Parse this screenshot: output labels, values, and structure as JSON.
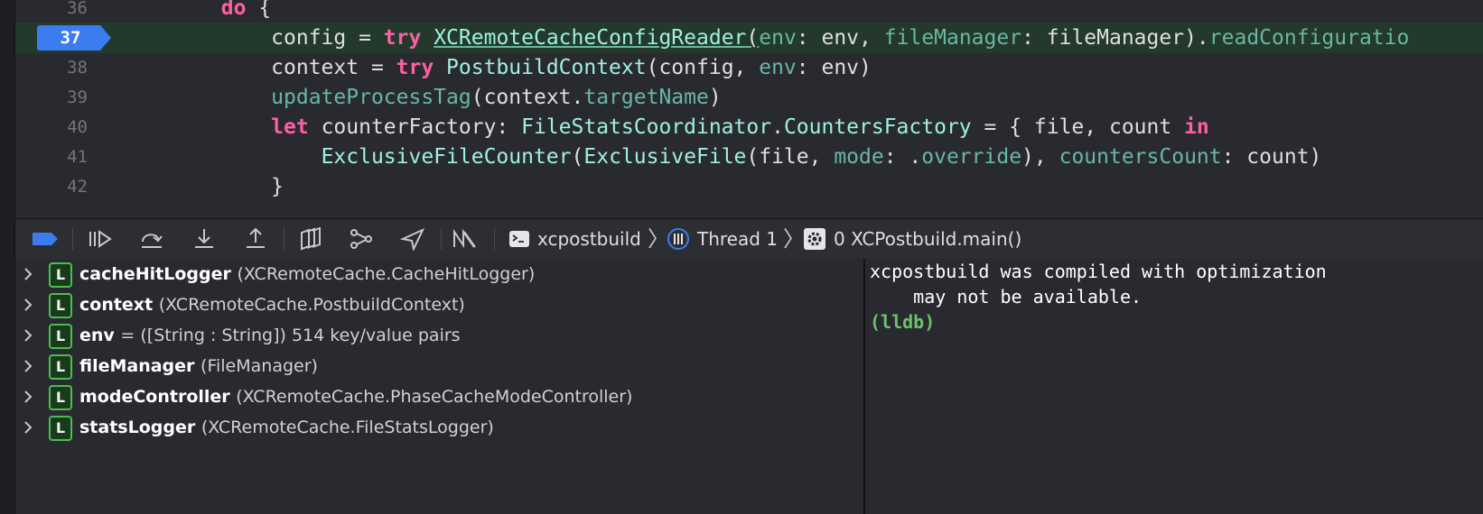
{
  "editor": {
    "lines": [
      {
        "number": "36",
        "tokens": [
          {
            "t": "        ",
            "c": "pl"
          },
          {
            "t": "do",
            "c": "kw"
          },
          {
            "t": " {",
            "c": "pl"
          }
        ]
      },
      {
        "number": "37",
        "current": true,
        "tokens": [
          {
            "t": "            config = ",
            "c": "pl"
          },
          {
            "t": "try",
            "c": "kw"
          },
          {
            "t": " ",
            "c": "pl"
          },
          {
            "t": "XCRemoteCacheConfigReader",
            "c": "ty",
            "u": true
          },
          {
            "t": "(",
            "c": "pl",
            "u": true
          },
          {
            "t": "env",
            "c": "fn"
          },
          {
            "t": ": env, ",
            "c": "pl"
          },
          {
            "t": "fileManager",
            "c": "fn"
          },
          {
            "t": ": fileManager).",
            "c": "pl"
          },
          {
            "t": "readConfiguratio",
            "c": "fn"
          }
        ]
      },
      {
        "number": "38",
        "tokens": [
          {
            "t": "            context = ",
            "c": "pl"
          },
          {
            "t": "try",
            "c": "kw"
          },
          {
            "t": " ",
            "c": "pl"
          },
          {
            "t": "PostbuildContext",
            "c": "ty"
          },
          {
            "t": "(config, ",
            "c": "pl"
          },
          {
            "t": "env",
            "c": "fn"
          },
          {
            "t": ": env)",
            "c": "pl"
          }
        ]
      },
      {
        "number": "39",
        "tokens": [
          {
            "t": "            ",
            "c": "pl"
          },
          {
            "t": "updateProcessTag",
            "c": "fn"
          },
          {
            "t": "(context.",
            "c": "pl"
          },
          {
            "t": "targetName",
            "c": "fn"
          },
          {
            "t": ")",
            "c": "pl"
          }
        ]
      },
      {
        "number": "40",
        "tokens": [
          {
            "t": "            ",
            "c": "pl"
          },
          {
            "t": "let",
            "c": "kw"
          },
          {
            "t": " counterFactory: ",
            "c": "pl"
          },
          {
            "t": "FileStatsCoordinator",
            "c": "ty"
          },
          {
            "t": ".",
            "c": "pl"
          },
          {
            "t": "CountersFactory",
            "c": "ty"
          },
          {
            "t": " = { file, count ",
            "c": "pl"
          },
          {
            "t": "in",
            "c": "kw"
          }
        ]
      },
      {
        "number": "41",
        "tokens": [
          {
            "t": "                ",
            "c": "pl"
          },
          {
            "t": "ExclusiveFileCounter",
            "c": "ty"
          },
          {
            "t": "(",
            "c": "pl"
          },
          {
            "t": "ExclusiveFile",
            "c": "ty"
          },
          {
            "t": "(file, ",
            "c": "pl"
          },
          {
            "t": "mode",
            "c": "fn"
          },
          {
            "t": ": .",
            "c": "pl"
          },
          {
            "t": "override",
            "c": "fn"
          },
          {
            "t": "), ",
            "c": "pl"
          },
          {
            "t": "countersCount",
            "c": "fn"
          },
          {
            "t": ": count)",
            "c": "pl"
          }
        ]
      },
      {
        "number": "42",
        "tokens": [
          {
            "t": "            }",
            "c": "pl"
          }
        ]
      }
    ]
  },
  "debug_bar": {
    "buttons": [
      {
        "name": "toggle-breakpoints-icon"
      },
      {
        "name": "continue-icon"
      },
      {
        "name": "step-over-icon"
      },
      {
        "name": "step-into-icon"
      },
      {
        "name": "step-out-icon"
      },
      {
        "name": "view-hierarchy-icon"
      },
      {
        "name": "memory-graph-icon"
      },
      {
        "name": "simulate-location-icon"
      },
      {
        "name": "environment-overrides-icon"
      }
    ],
    "breadcrumbs": {
      "process": "xcpostbuild",
      "thread": "Thread 1",
      "frame": "0 XCPostbuild.main()"
    }
  },
  "variables": [
    {
      "badge": "L",
      "name": "cacheHitLogger",
      "detail": "(XCRemoteCache.CacheHitLogger)"
    },
    {
      "badge": "L",
      "name": "context",
      "detail": "(XCRemoteCache.PostbuildContext)"
    },
    {
      "badge": "L",
      "name": "env",
      "detail": "= ([String : String]) 514 key/value pairs"
    },
    {
      "badge": "L",
      "name": "fileManager",
      "detail": "(FileManager)"
    },
    {
      "badge": "L",
      "name": "modeController",
      "detail": "(XCRemoteCache.PhaseCacheModeController)"
    },
    {
      "badge": "L",
      "name": "statsLogger",
      "detail": "(XCRemoteCache.FileStatsLogger)"
    }
  ],
  "console": {
    "line1": "xcpostbuild was compiled with optimization",
    "line2": "    may not be available.",
    "prompt": "(lldb)"
  },
  "colors": {
    "background": "#292a30",
    "current_line": "#23392b",
    "breakpoint": "#3b7cf0",
    "keyword": "#fc5fa3",
    "type": "#9ef1dd",
    "function": "#67b7a4",
    "badge_green": "#4bbd52"
  }
}
